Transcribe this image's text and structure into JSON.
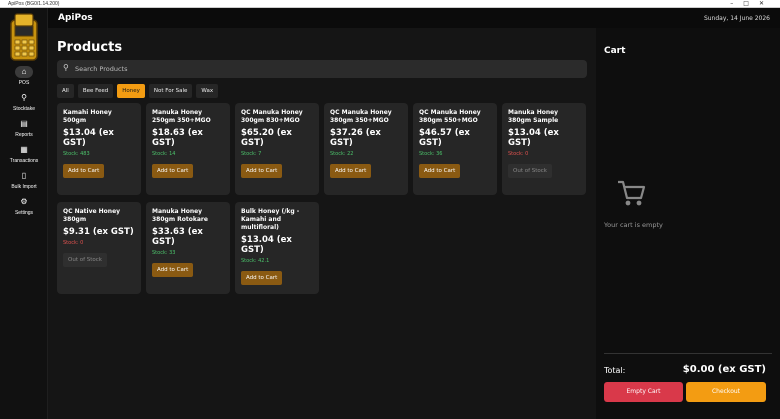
{
  "window": {
    "title": "ApiPos (BG0/1.14.200)"
  },
  "header": {
    "app_name": "ApiPos",
    "date": "Sunday, 14 June 2026"
  },
  "sidebar": {
    "items": [
      {
        "label": "POS",
        "icon": "home-icon",
        "active": true
      },
      {
        "label": "Stocktake",
        "icon": "search-icon",
        "active": false
      },
      {
        "label": "Reports",
        "icon": "chart-icon",
        "active": false
      },
      {
        "label": "Transactions",
        "icon": "receipt-icon",
        "active": false
      },
      {
        "label": "Bulk Import",
        "icon": "file-icon",
        "active": false
      },
      {
        "label": "Settings",
        "icon": "gear-icon",
        "active": false
      }
    ]
  },
  "main": {
    "title": "Products",
    "search_placeholder": "Search Products",
    "filters": [
      {
        "label": "All",
        "active": false
      },
      {
        "label": "Bee Feed",
        "active": false
      },
      {
        "label": "Honey",
        "active": true
      },
      {
        "label": "Not For Sale",
        "active": false
      },
      {
        "label": "Wax",
        "active": false
      }
    ],
    "products": [
      {
        "name": "Kamahi Honey 500gm",
        "price": "$13.04 (ex GST)",
        "stock": "Stock: 483",
        "in_stock": true,
        "button": "Add to Cart"
      },
      {
        "name": "Manuka Honey 250gm 350+MGO",
        "price": "$18.63 (ex GST)",
        "stock": "Stock: 14",
        "in_stock": true,
        "button": "Add to Cart"
      },
      {
        "name": "QC Manuka Honey 300gm 830+MGO",
        "price": "$65.20 (ex GST)",
        "stock": "Stock: 7",
        "in_stock": true,
        "button": "Add to Cart"
      },
      {
        "name": "QC Manuka Honey 380gm 350+MGO",
        "price": "$37.26 (ex GST)",
        "stock": "Stock: 22",
        "in_stock": true,
        "button": "Add to Cart"
      },
      {
        "name": "QC Manuka Honey 380gm 550+MGO",
        "price": "$46.57 (ex GST)",
        "stock": "Stock: 36",
        "in_stock": true,
        "button": "Add to Cart"
      },
      {
        "name": "Manuka Honey 380gm Sample",
        "price": "$13.04 (ex GST)",
        "stock": "Stock: 0",
        "in_stock": false,
        "button": "Out of Stock"
      },
      {
        "name": "QC Native Honey 380gm",
        "price": "$9.31 (ex GST)",
        "stock": "Stock: 0",
        "in_stock": false,
        "button": "Out of Stock"
      },
      {
        "name": "Manuka Honey 380gm Rotokare",
        "price": "$33.63 (ex GST)",
        "stock": "Stock: 33",
        "in_stock": true,
        "button": "Add to Cart"
      },
      {
        "name": "Bulk Honey (/kg - Kamahi and multifloral)",
        "price": "$13.04 (ex GST)",
        "stock": "Stock: 42.1",
        "in_stock": true,
        "button": "Add to Cart"
      }
    ]
  },
  "cart": {
    "title": "Cart",
    "empty_text": "Your cart is empty",
    "total_label": "Total:",
    "total_value": "$0.00 (ex GST)",
    "empty_button": "Empty Cart",
    "checkout_button": "Checkout"
  },
  "colors": {
    "accent": "#f39c12",
    "danger": "#d9394a",
    "stock_ok": "#4cc36b",
    "stock_zero": "#e0524f",
    "add_button": "#8a5a12"
  }
}
